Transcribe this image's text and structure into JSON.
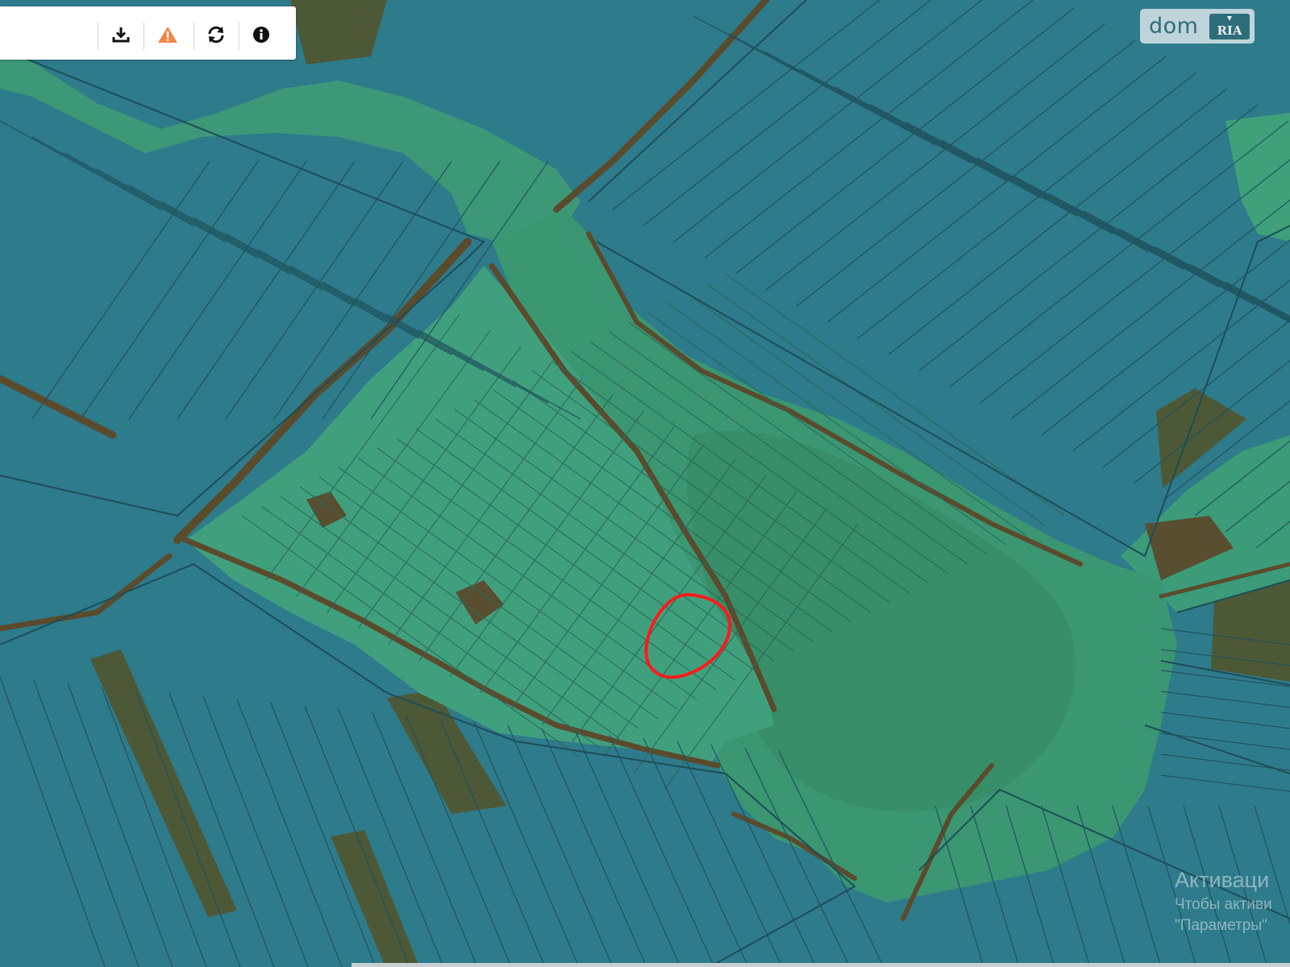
{
  "map": {
    "colors": {
      "parcel_blue": "#2f7f90",
      "parcel_green": "#3f9e7c",
      "lake_green": "#3a936f",
      "field_brown": "#4e5a38",
      "line": "#1e4e55",
      "road": "#5a4a2e",
      "highlight": "#ff1a1a"
    },
    "highlight_marker": "hand-drawn red circle around selected parcel"
  },
  "toolbar": {
    "buttons": [
      {
        "icon": "download-icon",
        "color": "#111111"
      },
      {
        "icon": "warning-icon",
        "color": "#f0874a"
      },
      {
        "icon": "refresh-icon",
        "color": "#111111"
      },
      {
        "icon": "info-icon",
        "color": "#111111"
      }
    ]
  },
  "logo": {
    "text": "dom",
    "badge": "RIA"
  },
  "watermark": {
    "line1": "Активаци",
    "line2": "Чтобы активи",
    "line3": "\"Параметры\""
  }
}
